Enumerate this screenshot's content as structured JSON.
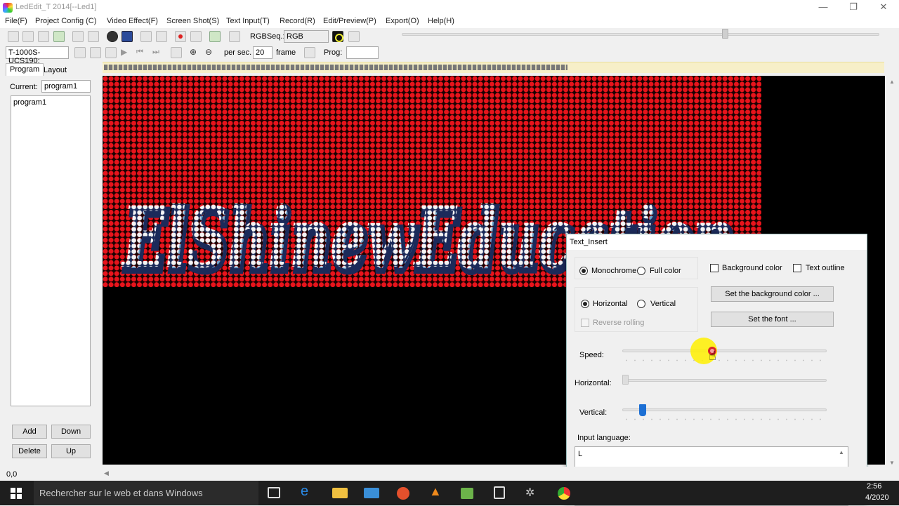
{
  "window": {
    "title": "LedEdit_T 2014[--Led1]",
    "controls": {
      "minimize": "—",
      "restore": "❐",
      "close": "✕"
    }
  },
  "menu": [
    "File(F)",
    "Project Config (C)",
    "Video Effect(F)",
    "Screen Shot(S)",
    "Text Input(T)",
    "Record(R)",
    "Edit/Preview(P)",
    "Export(O)",
    "Help(H)"
  ],
  "toolbar1": {
    "rgbseq_label": "RGBSeq.:",
    "rgbseq_value": "RGB"
  },
  "toolbar2": {
    "controller": "T-1000S-UCS190:",
    "per_sec_label": "per sec.",
    "per_sec_value": "20",
    "frame_label": "frame",
    "prog_label": "Prog:",
    "prog_value": ""
  },
  "left_panel": {
    "tabs": [
      "Program",
      "Layout"
    ],
    "current_label": "Current:",
    "current_value": "program1",
    "programs": [
      "program1"
    ],
    "buttons": {
      "add": "Add",
      "down": "Down",
      "delete": "Delete",
      "up": "Up"
    }
  },
  "led_display": {
    "scroll_text": "ElShinewEducation",
    "led_color": "#e8141c",
    "text_color": "#ffffff"
  },
  "dialog": {
    "title": "Text_Insert",
    "mode": {
      "monochrome": "Monochrome",
      "full_color": "Full color",
      "selected": "Monochrome"
    },
    "direction": {
      "horizontal": "Horizontal",
      "vertical": "Vertical",
      "selected": "Horizontal"
    },
    "reverse_rolling": "Reverse rolling",
    "background_color_check": "Background color",
    "text_outline_check": "Text outline",
    "set_bg_button": "Set the background color ...",
    "set_font_button": "Set the font ...",
    "speed_label": "Speed:",
    "horizontal_label": "Horizontal:",
    "vertical_label": "Vertical:",
    "speed_level": 0.44,
    "horizontal_level": 0.0,
    "vertical_level": 0.1,
    "input_language_label": "Input language:",
    "input_text": "L"
  },
  "status": {
    "coords": "0,0"
  },
  "taskbar": {
    "search_placeholder": "Rechercher sur le web et dans Windows",
    "time": "2:56",
    "date": "4/2020"
  }
}
